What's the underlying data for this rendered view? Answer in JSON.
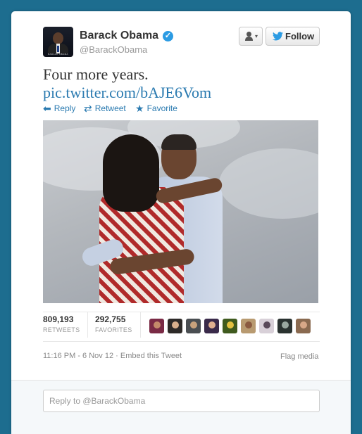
{
  "user": {
    "name": "Barack Obama",
    "handle": "@BarackObama",
    "avatar_caption": "BARACK OBAMA",
    "verified_glyph": "✓"
  },
  "header": {
    "follow_label": "Follow",
    "user_menu_caret": "▾",
    "bird_glyph": "🐦"
  },
  "tweet": {
    "text": "Four more years.",
    "link": "pic.twitter.com/bAJE6Vom"
  },
  "actions": {
    "reply_label": "Reply",
    "retweet_label": "Retweet",
    "favorite_label": "Favorite",
    "reply_icon": "⬅",
    "retweet_icon": "⇄",
    "favorite_icon": "★"
  },
  "stats": {
    "retweets_count": "809,193",
    "retweets_label": "RETWEETS",
    "favorites_count": "292,755",
    "favorites_label": "FAVORITES"
  },
  "favoriters": [
    {
      "bg": "#7a2a45",
      "face": "#c58a6a"
    },
    {
      "bg": "#2d2a28",
      "face": "#d9b08c"
    },
    {
      "bg": "#4a4e52",
      "face": "#c9a27c"
    },
    {
      "bg": "#3a2a4a",
      "face": "#e0b090"
    },
    {
      "bg": "#3f5a1e",
      "face": "#e3c040"
    },
    {
      "bg": "#b89a70",
      "face": "#8a5a40"
    },
    {
      "bg": "#d8d0d8",
      "face": "#5a4a5a"
    },
    {
      "bg": "#2a3230",
      "face": "#9aa8a0"
    },
    {
      "bg": "#8a6a50",
      "face": "#d8a888"
    }
  ],
  "meta": {
    "timestamp": "11:16 PM - 6 Nov 12",
    "separator": "·",
    "embed_label": "Embed this Tweet",
    "flag_label": "Flag media"
  },
  "reply": {
    "placeholder": "Reply to @BarackObama"
  }
}
